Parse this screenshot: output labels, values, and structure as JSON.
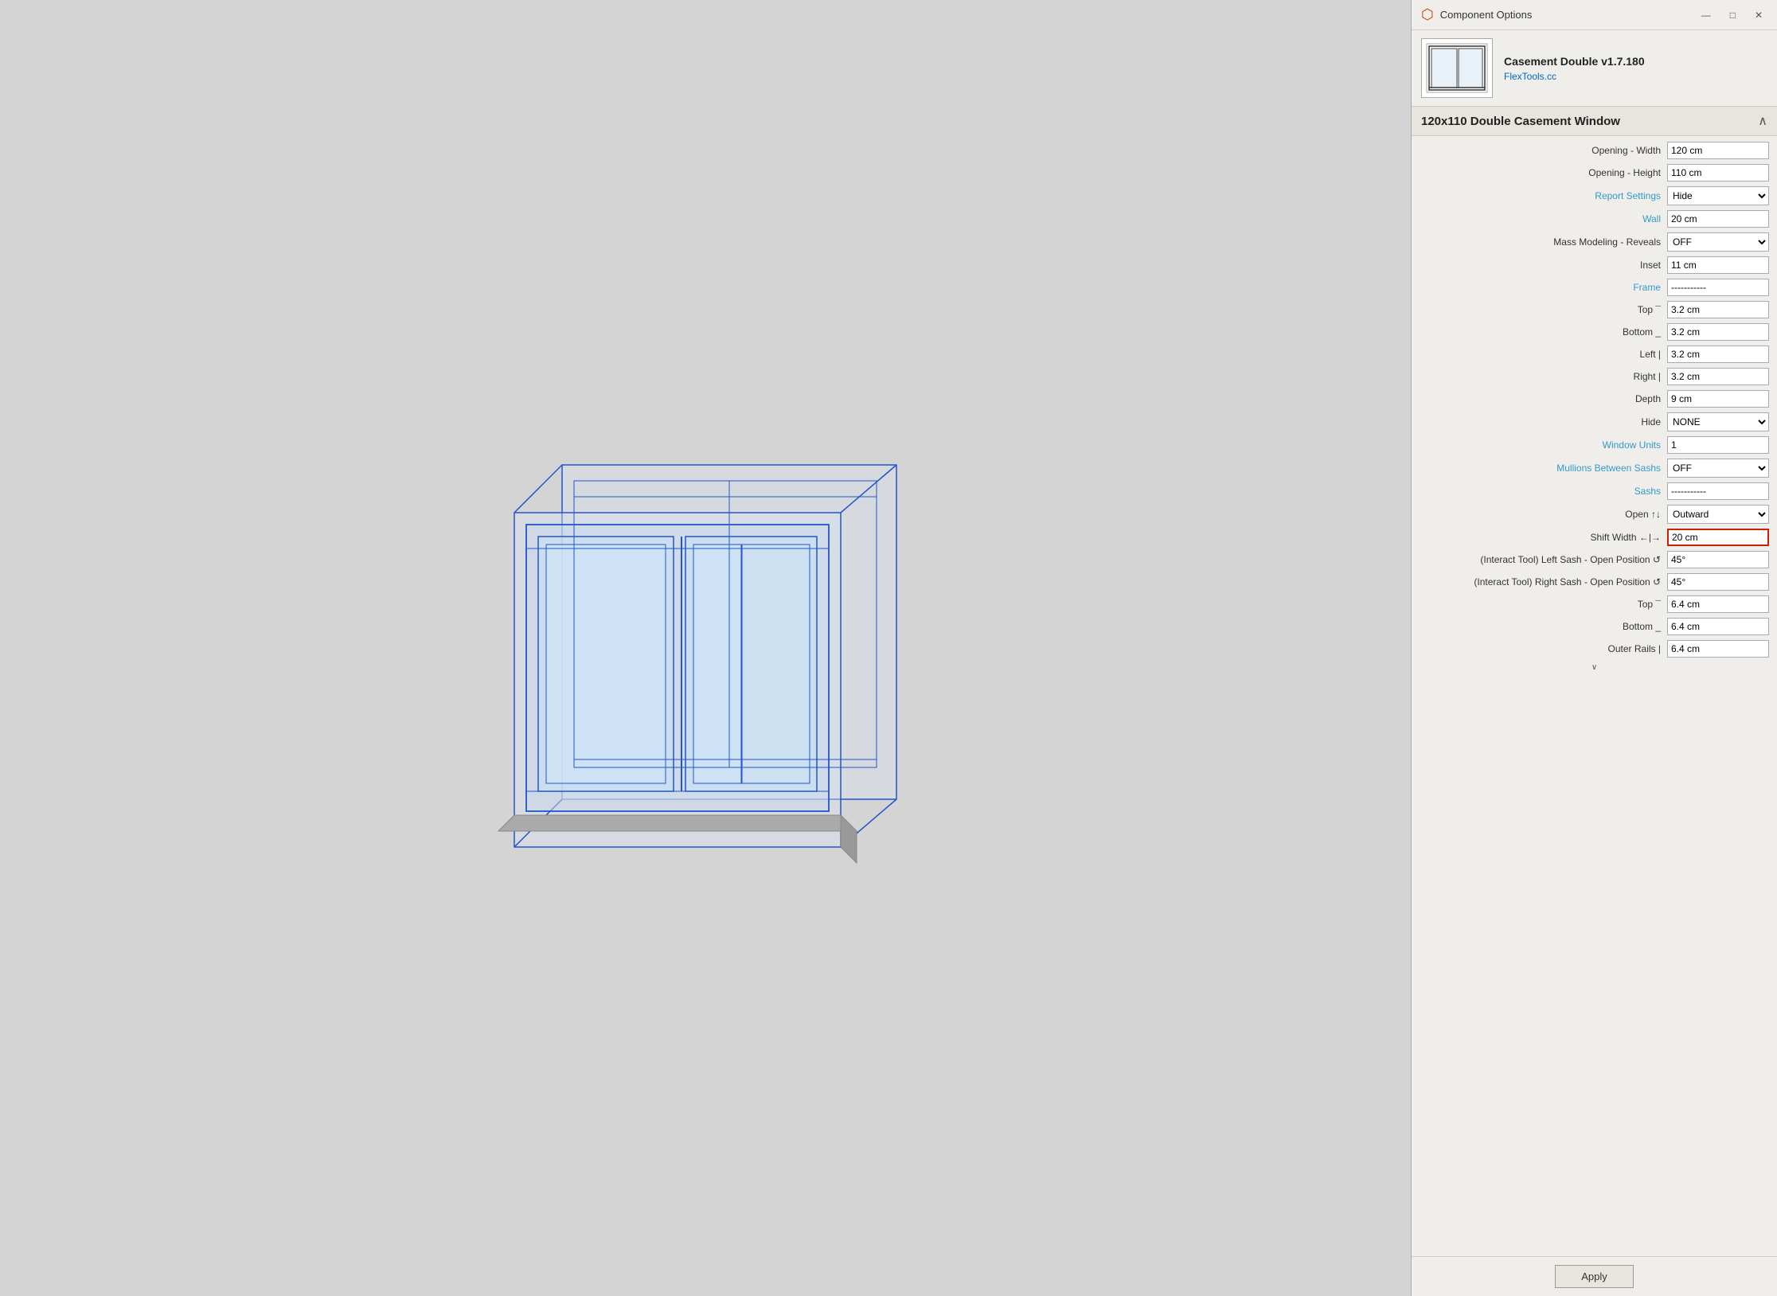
{
  "dialog": {
    "title": "Component Options",
    "title_icon": "◈",
    "min_label": "—",
    "max_label": "□",
    "close_label": "✕"
  },
  "component": {
    "name": "Casement Double v1.7.180",
    "link": "FlexTools.cc"
  },
  "section": {
    "title": "120x110 Double Casement Window"
  },
  "options": [
    {
      "label": "Opening - Width",
      "type": "input",
      "value": "120 cm",
      "highlighted": false
    },
    {
      "label": "Opening - Height",
      "type": "input",
      "value": "110 cm",
      "highlighted": false
    },
    {
      "label": "Report Settings",
      "type": "dashed-select",
      "value": "Hide",
      "highlighted": false
    },
    {
      "label": "Wall",
      "type": "dashed-input",
      "value": "20 cm",
      "highlighted": false
    },
    {
      "label": "Mass Modeling - Reveals",
      "type": "select",
      "value": "OFF",
      "highlighted": false
    },
    {
      "label": "Inset",
      "type": "input",
      "value": "11 cm",
      "highlighted": false
    },
    {
      "label": "Frame",
      "type": "dashed-input",
      "value": "-----------",
      "highlighted": false
    },
    {
      "label": "Top ¯",
      "type": "input",
      "value": "3.2 cm",
      "highlighted": false
    },
    {
      "label": "Bottom _",
      "type": "input",
      "value": "3.2 cm",
      "highlighted": false
    },
    {
      "label": "Left |",
      "type": "input",
      "value": "3.2 cm",
      "highlighted": false
    },
    {
      "label": "Right |",
      "type": "input",
      "value": "3.2 cm",
      "highlighted": false
    },
    {
      "label": "Depth",
      "type": "input",
      "value": "9 cm",
      "highlighted": false
    },
    {
      "label": "Hide",
      "type": "select",
      "value": "NONE",
      "highlighted": false
    },
    {
      "label": "Window Units",
      "type": "dashed-input",
      "value": "1",
      "highlighted": false
    },
    {
      "label": "Mullions Between Sashs",
      "type": "dashed-select",
      "value": "OFF",
      "highlighted": false
    },
    {
      "label": "Sashs",
      "type": "dashed-input",
      "value": "-----------",
      "highlighted": false
    },
    {
      "label": "Open ↑↓",
      "type": "select",
      "value": "Outward",
      "highlighted": false
    },
    {
      "label": "Shift Width ←|→",
      "type": "input",
      "value": "20 cm",
      "highlighted": true
    },
    {
      "label": "(Interact Tool) Left Sash - Open Position ↺",
      "type": "input",
      "value": "45°",
      "highlighted": false
    },
    {
      "label": "(Interact Tool) Right Sash - Open Position ↺",
      "type": "input",
      "value": "45°",
      "highlighted": false
    },
    {
      "label": "Top ¯",
      "type": "input",
      "value": "6.4 cm",
      "highlighted": false
    },
    {
      "label": "Bottom _",
      "type": "input",
      "value": "6.4 cm",
      "highlighted": false
    },
    {
      "label": "Outer Rails |",
      "type": "input",
      "value": "6.4 cm",
      "highlighted": false
    }
  ],
  "footer": {
    "apply_label": "Apply"
  }
}
